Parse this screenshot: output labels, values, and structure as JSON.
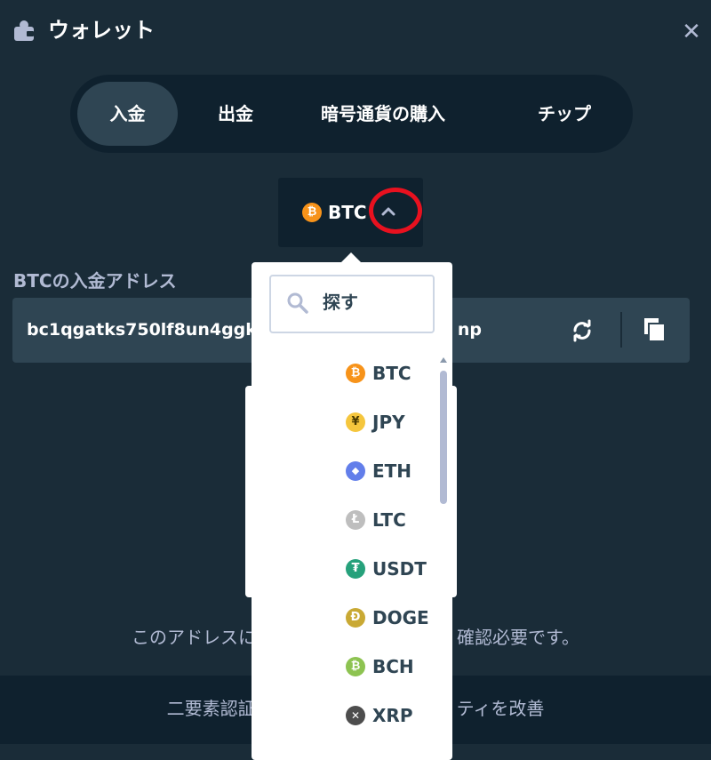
{
  "header": {
    "title": "ウォレット",
    "close_icon": "close-icon"
  },
  "tabs": [
    {
      "label": "入金",
      "active": true
    },
    {
      "label": "出金",
      "active": false
    },
    {
      "label": "暗号通貨の購入",
      "active": false
    },
    {
      "label": "チップ",
      "active": false
    }
  ],
  "currency_selector": {
    "selected": "BTC",
    "symbol": "₿",
    "icon": "btc-icon",
    "expanded": true
  },
  "deposit": {
    "address_label": "BTCの入金アドレス",
    "address_visible_start": "bc1qgatks750lf8un4ggk",
    "address_visible_end": "np",
    "notice_start": "このアドレスに",
    "notice_end": "確認必要です。"
  },
  "footer": {
    "text_start": "二要素認証",
    "text_end": "ティを改善"
  },
  "dropdown": {
    "search_placeholder": "探す",
    "items": [
      {
        "code": "BTC",
        "symbol": "₿",
        "color": "#f7931a",
        "icon": "btc-icon"
      },
      {
        "code": "JPY",
        "symbol": "¥",
        "color": "#f5c63d",
        "icon": "jpy-icon"
      },
      {
        "code": "ETH",
        "symbol": "◆",
        "color": "#627eea",
        "icon": "eth-icon"
      },
      {
        "code": "LTC",
        "symbol": "Ł",
        "color": "#bebebe",
        "icon": "ltc-icon"
      },
      {
        "code": "USDT",
        "symbol": "₮",
        "color": "#26a17b",
        "icon": "usdt-icon"
      },
      {
        "code": "DOGE",
        "symbol": "Ð",
        "color": "#c9a934",
        "icon": "doge-icon"
      },
      {
        "code": "BCH",
        "symbol": "₿",
        "color": "#8dc351",
        "icon": "bch-icon"
      },
      {
        "code": "XRP",
        "symbol": "✕",
        "color": "#4d4d4d",
        "icon": "xrp-icon"
      }
    ]
  },
  "colors": {
    "background": "#1a2c38",
    "panel": "#0f212e",
    "input": "#2f4553",
    "muted_text": "#b1bad3",
    "highlight": "#e8111f"
  }
}
